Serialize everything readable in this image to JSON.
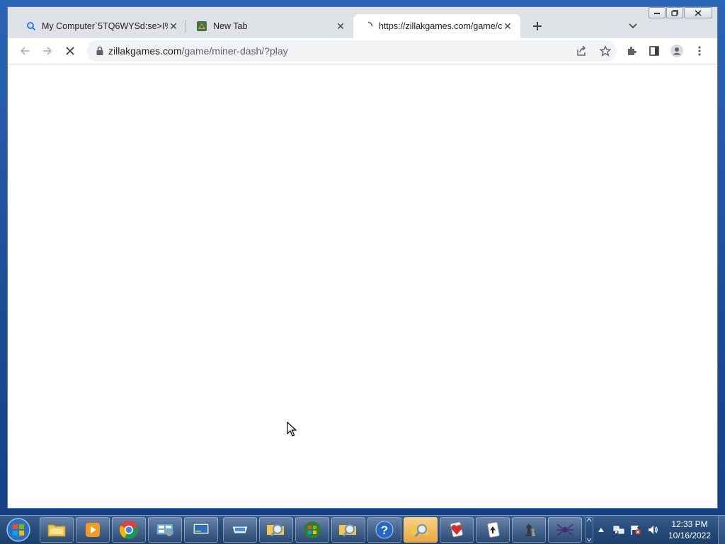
{
  "browser": {
    "tabs": [
      {
        "title": "My Computer`5TQ6WYSd:se>I%-",
        "active": false,
        "icon": "search-icon"
      },
      {
        "title": "New Tab",
        "active": false,
        "icon": "game-favicon"
      },
      {
        "title": "https://zillakgames.com/game/c",
        "active": true,
        "icon": "loading-spinner-icon"
      }
    ],
    "address": {
      "domain": "zillakgames.com",
      "path": "/game/miner-dash/?play"
    },
    "loading": true
  },
  "taskbar": {
    "apps": [
      "file-explorer",
      "media-player",
      "chrome",
      "control-panel",
      "remote-desktop",
      "scanner",
      "search-tool",
      "windows-update",
      "search-tool",
      "help",
      "search-tool",
      "hearts",
      "solitaire",
      "chess",
      "spider-solitaire"
    ],
    "highlighted": "search-tool",
    "clock": {
      "time": "12:33 PM",
      "date": "10/16/2022"
    }
  },
  "colors": {
    "accent": "#1a73e8",
    "tab_bg": "#dee1e6",
    "taskbar": "#274d7d"
  }
}
